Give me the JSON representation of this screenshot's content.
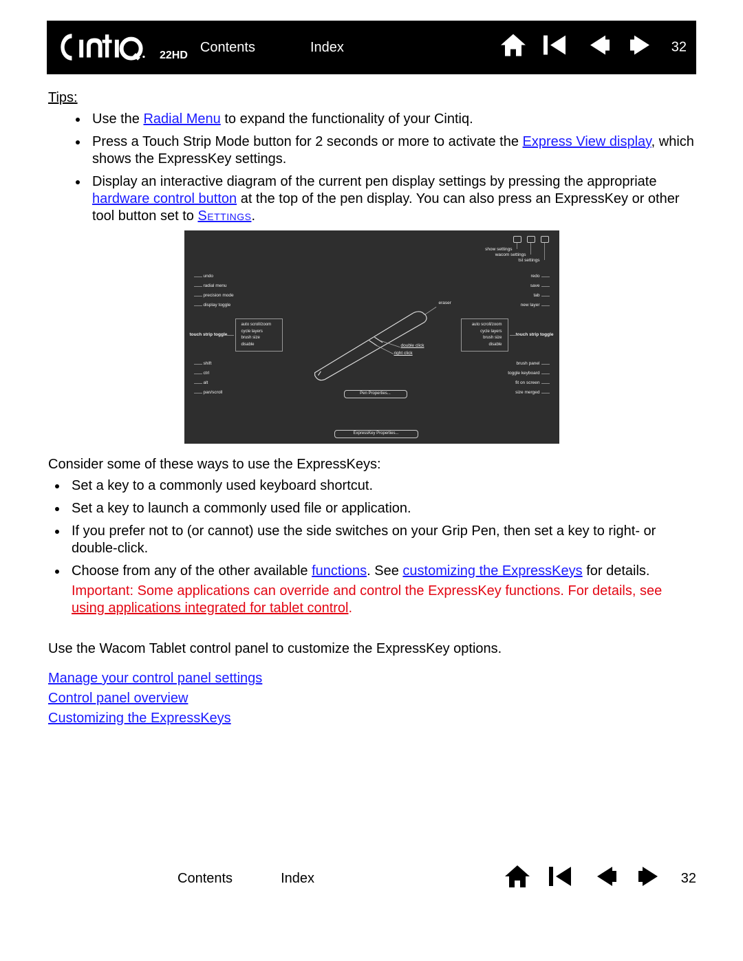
{
  "brand_suffix": "22HD",
  "page_number": "32",
  "header": {
    "contents": "Contents",
    "index": "Index"
  },
  "tips_label": "Tips",
  "tips": [
    {
      "prefix": "Use the ",
      "link1": "Radial Menu",
      "suffix": " to expand the functionality of your Cintiq."
    },
    {
      "prefix": "Press a Touch Strip Mode button for 2 seconds or more to activate the ",
      "link1": "Express View display",
      "suffix": ", which shows the ExpressKey settings."
    },
    {
      "prefix": "Display an interactive diagram of the current pen display settings by pressing the appropriate ",
      "link1": "hardware control button",
      "mid": " at the top of the pen display.  You can also press an ExpressKey or other tool button set to ",
      "link2": "Settings",
      "suffix": "."
    }
  ],
  "consider_text": "Consider some of these ways to use the ExpressKeys:",
  "ways": [
    "Set a key to a commonly used keyboard shortcut.",
    "Set a key to launch a commonly used file or application.",
    "If you prefer not to (or cannot) use the side switches on your Grip Pen, then set a key to right- or double-click."
  ],
  "ways_last": {
    "prefix": "Choose from any of the other available ",
    "link1": "functions",
    "mid": ".  See ",
    "link2": "customizing the ExpressKeys",
    "suffix": " for details."
  },
  "important": {
    "prefix": "Important: Some applications can override and control the ExpressKey functions.  For details, see ",
    "link": "using applications integrated for tablet control",
    "suffix": "."
  },
  "use_panel_text": "Use the Wacom Tablet control panel to customize the ExpressKey options.",
  "bottom_links": [
    "Manage your control panel settings",
    "Control panel overview",
    "Customizing the ExpressKeys"
  ],
  "diagram": {
    "top_right": [
      "show settings",
      "wacom settings",
      "tst settings"
    ],
    "left_top": [
      "undo",
      "radial menu",
      "precision mode",
      "display toggle"
    ],
    "left_bottom": [
      "shift",
      "ctrl",
      "alt",
      "pan/scroll"
    ],
    "left_ts": {
      "title": "touch strip toggle",
      "rows": [
        "auto scroll/zoom",
        "cycle layers",
        "brush size",
        "disable"
      ]
    },
    "right_top": [
      "redo",
      "save",
      "tab",
      "new layer"
    ],
    "right_bottom": [
      "brush panel",
      "toggle keyboard",
      "fit on screen",
      "size merged"
    ],
    "right_ts": {
      "title": "touch strip toggle",
      "rows": [
        "auto scroll/zoom",
        "cycle layers",
        "brush size",
        "disable"
      ]
    },
    "pen": {
      "tip": "eraser",
      "mid": "double click",
      "lower": "right click"
    },
    "btn_pen": "Pen Properties...",
    "btn_ek": "ExpressKey Properties..."
  }
}
